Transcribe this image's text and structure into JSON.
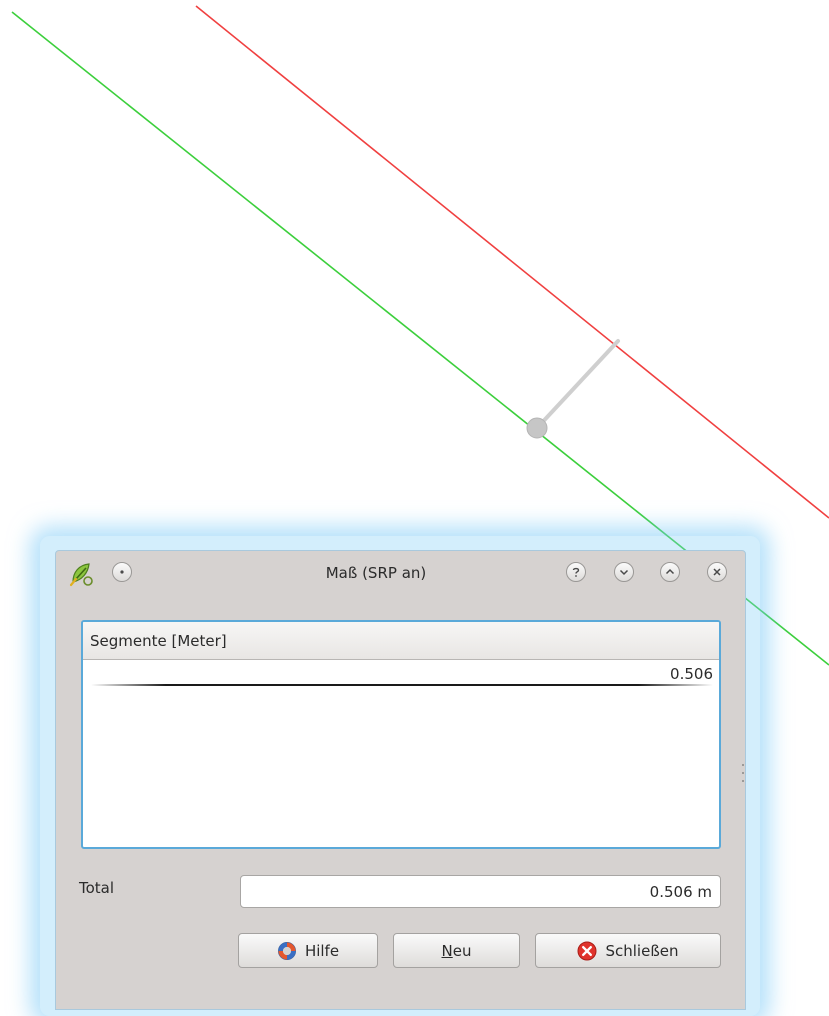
{
  "dialog": {
    "title": "Maß (SRP an)",
    "table": {
      "header": "Segmente [Meter]",
      "rows": [
        "0.506"
      ]
    },
    "total": {
      "label": "Total",
      "value": "0.506 m"
    },
    "buttons": {
      "help": "Hilfe",
      "new": "Neu",
      "close": "Schließen"
    }
  },
  "colors": {
    "green_line": "#3ccf3c",
    "red_line": "#f04040",
    "measure_line": "#d0d0d0",
    "focus_border": "#5aa9d9"
  }
}
